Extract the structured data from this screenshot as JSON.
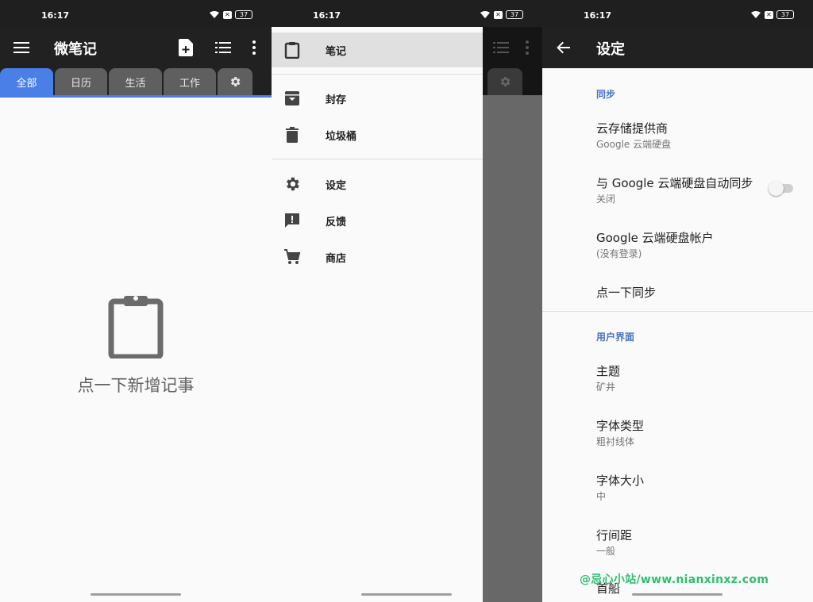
{
  "status_bar": {
    "time": "16:17",
    "battery": "37"
  },
  "notes_screen": {
    "title": "微笔记",
    "tabs": [
      "全部",
      "日历",
      "生活",
      "工作"
    ],
    "empty_text": "点一下新增记事"
  },
  "drawer": {
    "items": [
      {
        "label": "笔记",
        "icon": "clipboard-icon"
      },
      {
        "label": "封存",
        "icon": "archive-icon"
      },
      {
        "label": "垃圾桶",
        "icon": "trash-icon"
      },
      {
        "label": "设定",
        "icon": "gear-icon"
      },
      {
        "label": "反馈",
        "icon": "feedback-icon"
      },
      {
        "label": "商店",
        "icon": "cart-icon"
      }
    ]
  },
  "settings": {
    "title": "设定",
    "section_sync": "同步",
    "cloud_provider_title": "云存储提供商",
    "cloud_provider_value": "Google 云端硬盘",
    "auto_sync_title": "与 Google 云端硬盘自动同步",
    "auto_sync_value": "关闭",
    "account_title": "Google 云端硬盘帐户",
    "account_value": "(没有登录)",
    "tap_sync": "点一下同步",
    "section_ui": "用户界面",
    "theme_title": "主题",
    "theme_value": "矿井",
    "font_type_title": "字体类型",
    "font_type_value": "粗衬线体",
    "font_size_title": "字体大小",
    "font_size_value": "中",
    "line_spacing_title": "行间距",
    "line_spacing_value": "一般",
    "partial_next": "首船"
  },
  "watermark": "@忌心小站/www.nianxinxz.com",
  "colors": {
    "accent": "#4a7fe8",
    "appbar": "#212121",
    "section_header": "#4a72c2"
  }
}
